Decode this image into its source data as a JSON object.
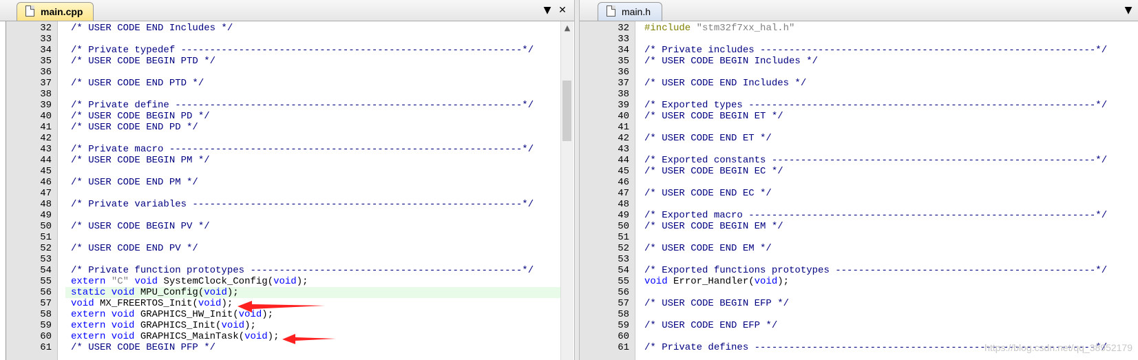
{
  "left": {
    "tab_label": "main.cpp",
    "lines": [
      {
        "n": "32",
        "parts": [
          [
            "c",
            "/* USER CODE END Includes */"
          ]
        ]
      },
      {
        "n": "33",
        "parts": []
      },
      {
        "n": "34",
        "parts": [
          [
            "c",
            "/* Private typedef -----------------------------------------------------------*/"
          ]
        ]
      },
      {
        "n": "35",
        "parts": [
          [
            "c",
            "/* USER CODE BEGIN PTD */"
          ]
        ]
      },
      {
        "n": "36",
        "parts": []
      },
      {
        "n": "37",
        "parts": [
          [
            "c",
            "/* USER CODE END PTD */"
          ]
        ]
      },
      {
        "n": "38",
        "parts": []
      },
      {
        "n": "39",
        "parts": [
          [
            "c",
            "/* Private define ------------------------------------------------------------*/"
          ]
        ]
      },
      {
        "n": "40",
        "parts": [
          [
            "c",
            "/* USER CODE BEGIN PD */"
          ]
        ]
      },
      {
        "n": "41",
        "parts": [
          [
            "c",
            "/* USER CODE END PD */"
          ]
        ]
      },
      {
        "n": "42",
        "parts": []
      },
      {
        "n": "43",
        "parts": [
          [
            "c",
            "/* Private macro -------------------------------------------------------------*/"
          ]
        ]
      },
      {
        "n": "44",
        "parts": [
          [
            "c",
            "/* USER CODE BEGIN PM */"
          ]
        ]
      },
      {
        "n": "45",
        "parts": []
      },
      {
        "n": "46",
        "parts": [
          [
            "c",
            "/* USER CODE END PM */"
          ]
        ]
      },
      {
        "n": "47",
        "parts": []
      },
      {
        "n": "48",
        "parts": [
          [
            "c",
            "/* Private variables ---------------------------------------------------------*/"
          ]
        ]
      },
      {
        "n": "49",
        "parts": []
      },
      {
        "n": "50",
        "parts": [
          [
            "c",
            "/* USER CODE BEGIN PV */"
          ]
        ]
      },
      {
        "n": "51",
        "parts": []
      },
      {
        "n": "52",
        "parts": [
          [
            "c",
            "/* USER CODE END PV */"
          ]
        ]
      },
      {
        "n": "53",
        "parts": []
      },
      {
        "n": "54",
        "parts": [
          [
            "c",
            "/* Private function prototypes -----------------------------------------------*/"
          ]
        ]
      },
      {
        "n": "55",
        "parts": [
          [
            "k",
            "extern "
          ],
          [
            "s",
            "\"C\""
          ],
          [
            "p",
            " "
          ],
          [
            "k",
            "void"
          ],
          [
            "p",
            " SystemClock_Config("
          ],
          [
            "k",
            "void"
          ],
          [
            "p",
            ");"
          ]
        ]
      },
      {
        "n": "56",
        "hl": true,
        "parts": [
          [
            "k",
            "static void"
          ],
          [
            "p",
            " MPU_Config("
          ],
          [
            "k",
            "void"
          ],
          [
            "p",
            ");"
          ]
        ]
      },
      {
        "n": "57",
        "parts": [
          [
            "k",
            "void"
          ],
          [
            "p",
            " MX_FREERTOS_Init("
          ],
          [
            "k",
            "void"
          ],
          [
            "p",
            ");"
          ]
        ]
      },
      {
        "n": "58",
        "parts": [
          [
            "k",
            "extern void"
          ],
          [
            "p",
            " GRAPHICS_HW_Init("
          ],
          [
            "k",
            "void"
          ],
          [
            "p",
            ");"
          ]
        ]
      },
      {
        "n": "59",
        "parts": [
          [
            "k",
            "extern void"
          ],
          [
            "p",
            " GRAPHICS_Init("
          ],
          [
            "k",
            "void"
          ],
          [
            "p",
            ");"
          ]
        ]
      },
      {
        "n": "60",
        "parts": [
          [
            "k",
            "extern void"
          ],
          [
            "p",
            " GRAPHICS_MainTask("
          ],
          [
            "k",
            "void"
          ],
          [
            "p",
            ");"
          ]
        ]
      },
      {
        "n": "61",
        "parts": [
          [
            "c",
            "/* USER CODE BEGIN PFP */"
          ]
        ]
      }
    ]
  },
  "right": {
    "tab_label": "main.h",
    "lines": [
      {
        "n": "32",
        "parts": [
          [
            "pp",
            "#include "
          ],
          [
            "s",
            "\"stm32f7xx_hal.h\""
          ]
        ]
      },
      {
        "n": "33",
        "parts": []
      },
      {
        "n": "34",
        "parts": [
          [
            "c",
            "/* Private includes ----------------------------------------------------------*/"
          ]
        ]
      },
      {
        "n": "35",
        "parts": [
          [
            "c",
            "/* USER CODE BEGIN Includes */"
          ]
        ]
      },
      {
        "n": "36",
        "parts": []
      },
      {
        "n": "37",
        "parts": [
          [
            "c",
            "/* USER CODE END Includes */"
          ]
        ]
      },
      {
        "n": "38",
        "parts": []
      },
      {
        "n": "39",
        "parts": [
          [
            "c",
            "/* Exported types ------------------------------------------------------------*/"
          ]
        ]
      },
      {
        "n": "40",
        "parts": [
          [
            "c",
            "/* USER CODE BEGIN ET */"
          ]
        ]
      },
      {
        "n": "41",
        "parts": []
      },
      {
        "n": "42",
        "parts": [
          [
            "c",
            "/* USER CODE END ET */"
          ]
        ]
      },
      {
        "n": "43",
        "parts": []
      },
      {
        "n": "44",
        "parts": [
          [
            "c",
            "/* Exported constants --------------------------------------------------------*/"
          ]
        ]
      },
      {
        "n": "45",
        "parts": [
          [
            "c",
            "/* USER CODE BEGIN EC */"
          ]
        ]
      },
      {
        "n": "46",
        "parts": []
      },
      {
        "n": "47",
        "parts": [
          [
            "c",
            "/* USER CODE END EC */"
          ]
        ]
      },
      {
        "n": "48",
        "parts": []
      },
      {
        "n": "49",
        "parts": [
          [
            "c",
            "/* Exported macro ------------------------------------------------------------*/"
          ]
        ]
      },
      {
        "n": "50",
        "parts": [
          [
            "c",
            "/* USER CODE BEGIN EM */"
          ]
        ]
      },
      {
        "n": "51",
        "parts": []
      },
      {
        "n": "52",
        "parts": [
          [
            "c",
            "/* USER CODE END EM */"
          ]
        ]
      },
      {
        "n": "53",
        "parts": []
      },
      {
        "n": "54",
        "parts": [
          [
            "c",
            "/* Exported functions prototypes ---------------------------------------------*/"
          ]
        ]
      },
      {
        "n": "55",
        "parts": [
          [
            "k",
            "void"
          ],
          [
            "p",
            " Error_Handler("
          ],
          [
            "k",
            "void"
          ],
          [
            "p",
            ");"
          ]
        ]
      },
      {
        "n": "56",
        "parts": []
      },
      {
        "n": "57",
        "parts": [
          [
            "c",
            "/* USER CODE BEGIN EFP */"
          ]
        ]
      },
      {
        "n": "58",
        "parts": []
      },
      {
        "n": "59",
        "parts": [
          [
            "c",
            "/* USER CODE END EFP */"
          ]
        ]
      },
      {
        "n": "60",
        "parts": []
      },
      {
        "n": "61",
        "parts": [
          [
            "c",
            "/* Private defines -----------------------------------------------------------*/"
          ]
        ]
      }
    ]
  },
  "watermark": "https://blog.csdn.net/qq_38952179",
  "icons": {
    "dropdown": "chevron-down-icon",
    "close": "close-icon",
    "scroll_up": "scroll-up-icon",
    "doc": "document-icon"
  },
  "colors": {
    "comment": "#000080",
    "keyword": "#0000ff",
    "string": "#808080",
    "preprocessor": "#808000",
    "highlight_line": "#e8fbe8",
    "annotation_arrow": "#ff2020"
  }
}
